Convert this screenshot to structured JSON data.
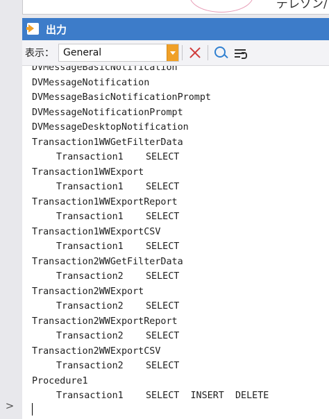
{
  "top_fragment": {
    "text": "デレゾン/"
  },
  "panel": {
    "title": "出力",
    "toolbar": {
      "label": "表示：",
      "select_value": "General"
    }
  },
  "output": {
    "lines": [
      {
        "text": "DVMessageBasicNotification",
        "indent": false
      },
      {
        "text": "DVMessageNotification",
        "indent": false
      },
      {
        "text": "DVMessageBasicNotificationPrompt",
        "indent": false
      },
      {
        "text": "DVMessageNotificationPrompt",
        "indent": false
      },
      {
        "text": "DVMessageDesktopNotification",
        "indent": false
      },
      {
        "text": "Transaction1WWGetFilterData",
        "indent": false
      },
      {
        "text": "Transaction1    SELECT",
        "indent": true
      },
      {
        "text": "Transaction1WWExport",
        "indent": false
      },
      {
        "text": "Transaction1    SELECT",
        "indent": true
      },
      {
        "text": "Transaction1WWExportReport",
        "indent": false
      },
      {
        "text": "Transaction1    SELECT",
        "indent": true
      },
      {
        "text": "Transaction1WWExportCSV",
        "indent": false
      },
      {
        "text": "Transaction1    SELECT",
        "indent": true
      },
      {
        "text": "Transaction2WWGetFilterData",
        "indent": false
      },
      {
        "text": "Transaction2    SELECT",
        "indent": true
      },
      {
        "text": "Transaction2WWExport",
        "indent": false
      },
      {
        "text": "Transaction2    SELECT",
        "indent": true
      },
      {
        "text": "Transaction2WWExportReport",
        "indent": false
      },
      {
        "text": "Transaction2    SELECT",
        "indent": true
      },
      {
        "text": "Transaction2WWExportCSV",
        "indent": false
      },
      {
        "text": "Transaction2    SELECT",
        "indent": true
      },
      {
        "text": "Procedure1",
        "indent": false
      },
      {
        "text": "Transaction1    SELECT  INSERT  DELETE",
        "indent": true
      }
    ]
  },
  "gutter": {
    "expand_glyph": ">"
  },
  "colors": {
    "header_bg": "#3d7cc9",
    "accent_orange": "#f0a028",
    "close_red": "#d03b3b",
    "search_blue": "#2f7fd0"
  },
  "icons": [
    "output-panel-icon",
    "dropdown-arrow-icon",
    "clear-x-icon",
    "find-icon",
    "word-wrap-icon",
    "expand-chevron-icon"
  ]
}
